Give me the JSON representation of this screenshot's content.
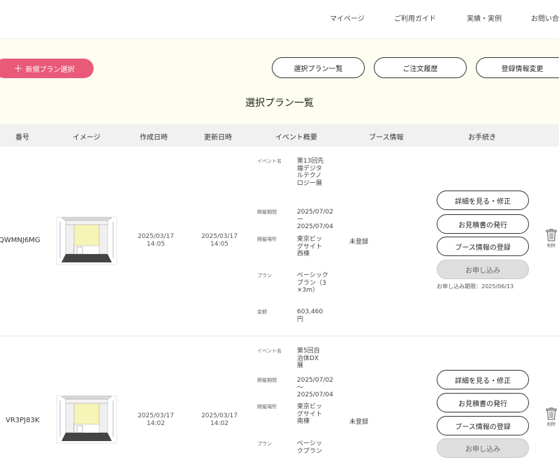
{
  "nav": {
    "links": [
      "マイページ",
      "ご利用ガイド",
      "実績・実例",
      "お問い合"
    ]
  },
  "toolbar": {
    "new_plan_label": "新規プラン選択",
    "plan_list_label": "選択プラン一覧",
    "order_history_label": "ご注文履歴",
    "profile_label": "登録情報変更"
  },
  "page_title": "選択プラン一覧",
  "table": {
    "headers": [
      "番号",
      "イメージ",
      "作成日時",
      "更新日時",
      "イベント概要",
      "ブース情報",
      "お手続き"
    ]
  },
  "event_labels": {
    "event_name": "イベント名",
    "period": "開催期間",
    "venue": "開催場所",
    "plan": "プラン",
    "amount": "金額"
  },
  "actions": {
    "details": "詳細を見る・修正",
    "estimate": "お見積書の発行",
    "booth_register": "ブース情報の登録",
    "apply": "お申し込み",
    "delete": "削除"
  },
  "rows": [
    {
      "id": "QWMNJ6MG",
      "created": "2025/03/17 14:05",
      "updated": "2025/03/17 14:05",
      "event_name": "第13回先端デジタルテクノロジー展",
      "period_start": "2025/07/02",
      "period_sep": "ー",
      "period_end": "2025/07/04",
      "venue": "東京ビッグサイト西棟",
      "plan": "ベーシックプラン（3×3m）",
      "amount": "603,460円",
      "booth": "未登録",
      "deadline": "お申し込み期限：2025/06/13"
    },
    {
      "id": "VR3PJ83K",
      "created": "2025/03/17 14:02",
      "updated": "2025/03/17 14:02",
      "event_name": "第5回自治体DX展",
      "period_start": "2025/07/02",
      "period_sep": "～",
      "period_end": "2025/07/04",
      "venue": "東京ビッグサイト南棟",
      "plan": "ベーシックプラン",
      "booth": "未登録"
    }
  ]
}
